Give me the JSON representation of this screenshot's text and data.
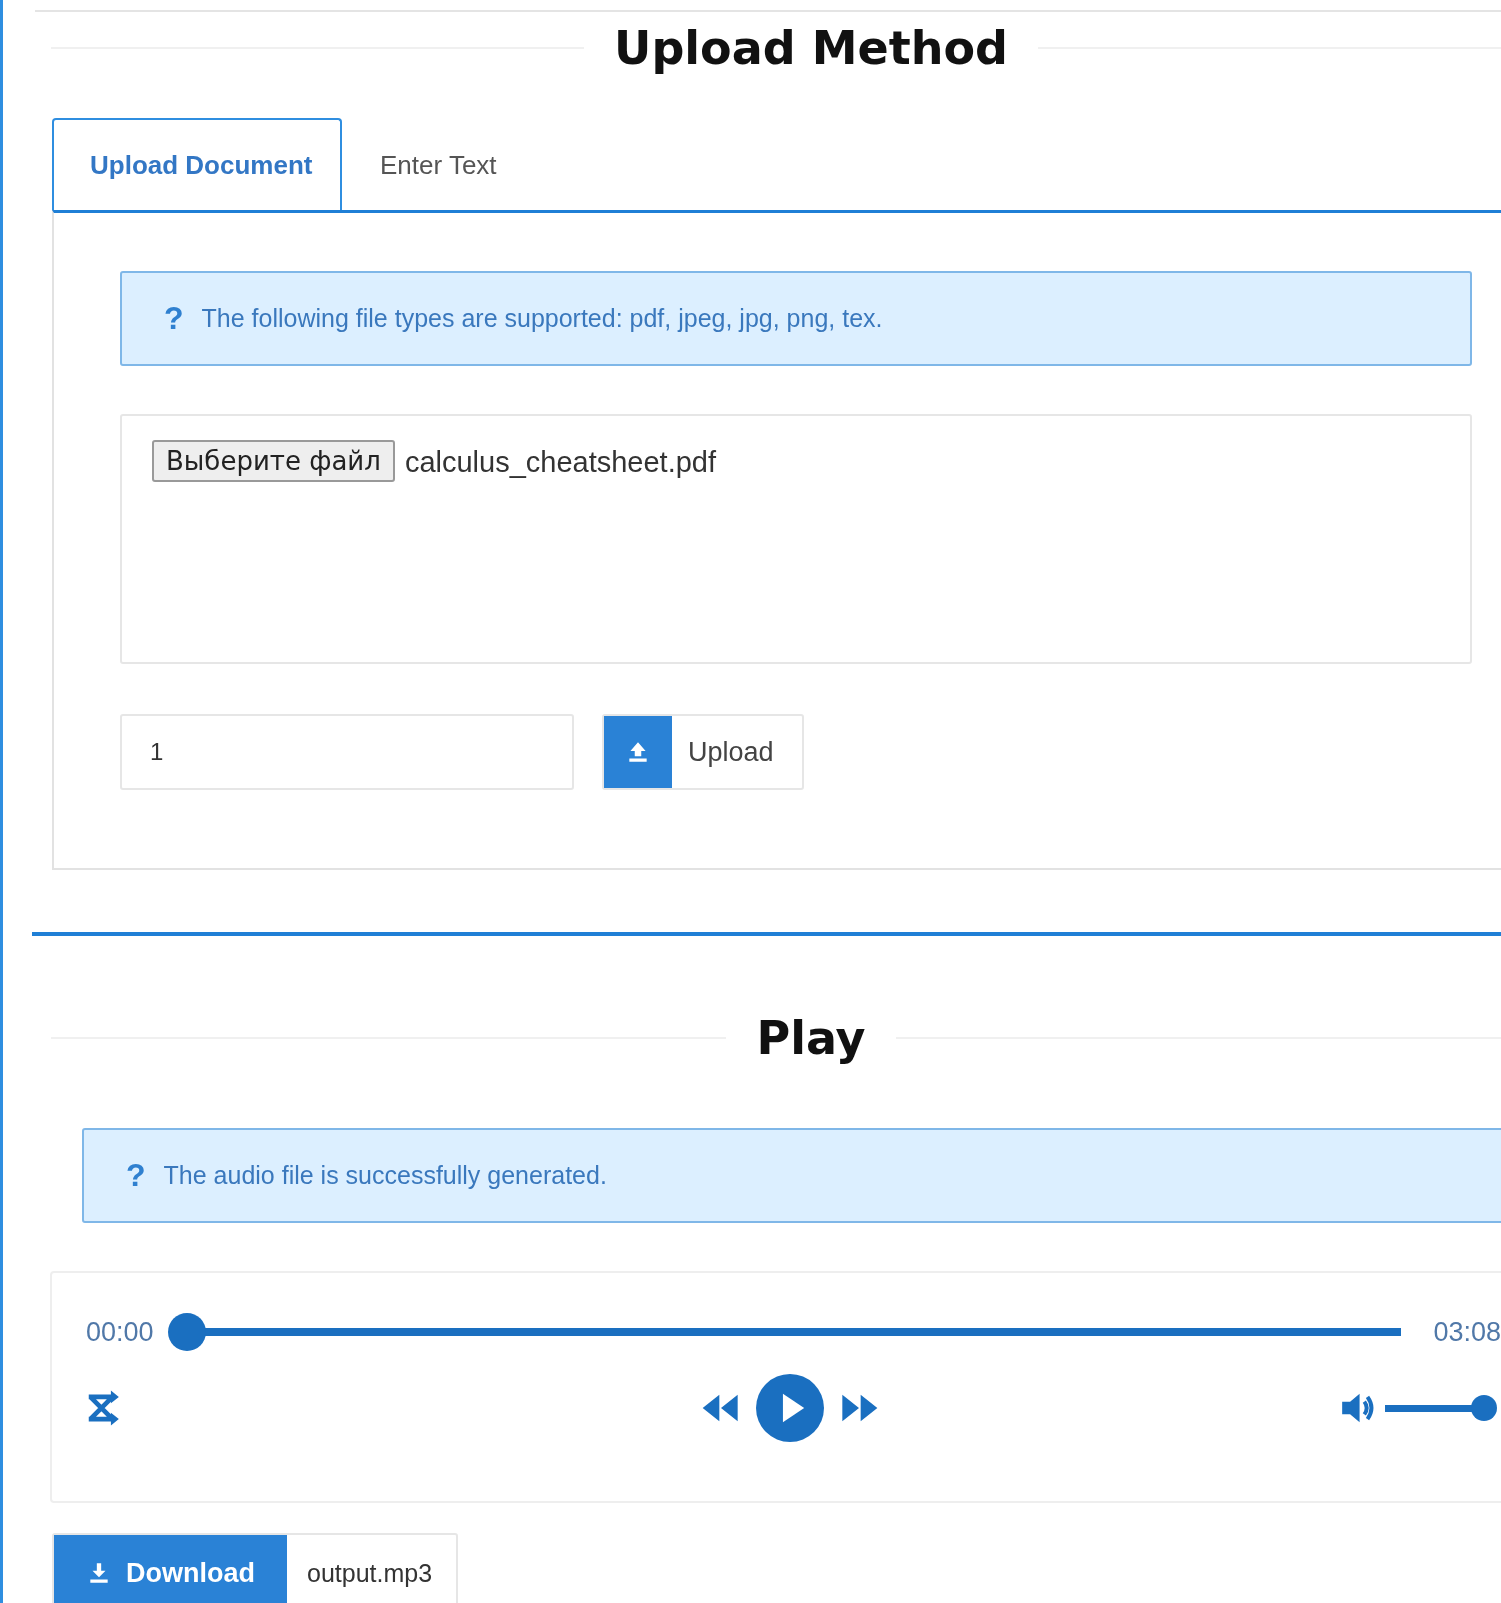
{
  "upload_section": {
    "title": "Upload Method",
    "tabs": [
      {
        "label": "Upload Document",
        "selected": true
      },
      {
        "label": "Enter Text",
        "selected": false
      }
    ],
    "info": {
      "icon": "?",
      "text": "The following file types are supported: pdf, jpeg, jpg, png, tex."
    },
    "file_picker": {
      "button": "Выберите файл",
      "file_name": "calculus_cheatsheet.pdf"
    },
    "number_field": {
      "value": "1"
    },
    "upload_button": {
      "label": "Upload"
    }
  },
  "play_section": {
    "title": "Play",
    "info": {
      "icon": "?",
      "text": "The audio file is successfully generated."
    },
    "player": {
      "elapsed": "00:00",
      "duration": "03:08",
      "progress": {
        "level": 0
      },
      "volume": {
        "level": 0.9
      }
    },
    "download_button": {
      "label": "Download",
      "file_name": "output.mp3"
    }
  }
}
